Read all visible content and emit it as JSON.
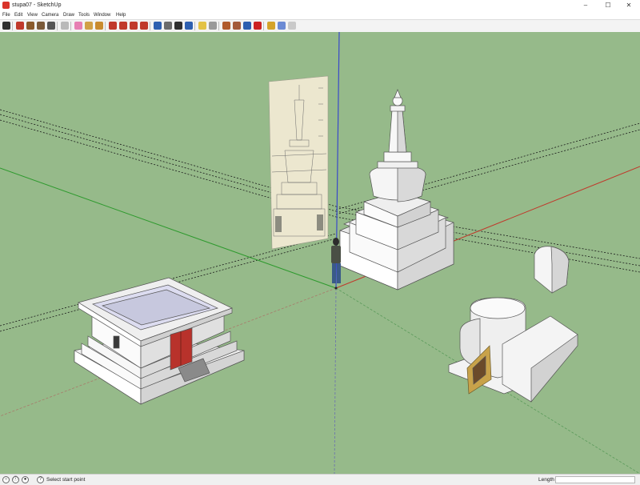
{
  "window": {
    "title": "stupa07 - SketchUp",
    "controls": {
      "minimize": "–",
      "maximize": "☐",
      "close": "✕"
    }
  },
  "menu": [
    "File",
    "Edit",
    "View",
    "Camera",
    "Draw",
    "Tools",
    "Window",
    "Help"
  ],
  "toolbar": {
    "tools": [
      {
        "name": "select-icon",
        "color": "#2f2f2f"
      },
      {
        "name": "line-icon",
        "color": "#c0392b"
      },
      {
        "name": "rectangle-icon",
        "color": "#8a5a2b"
      },
      {
        "name": "circle-icon",
        "color": "#7a5a3a"
      },
      {
        "name": "arc-icon",
        "color": "#555555"
      },
      {
        "name": "make-component-icon",
        "color": "#b9b9b9"
      },
      {
        "name": "eraser-icon",
        "color": "#e77fb3"
      },
      {
        "name": "tape-measure-icon",
        "color": "#d1a046"
      },
      {
        "name": "paint-bucket-icon",
        "color": "#c98b2e"
      },
      {
        "name": "push-pull-icon",
        "color": "#c0392b"
      },
      {
        "name": "move-icon",
        "color": "#c0392b"
      },
      {
        "name": "rotate-icon",
        "color": "#c0392b"
      },
      {
        "name": "offset-icon",
        "color": "#c0392b"
      },
      {
        "name": "orbit-icon",
        "color": "#2d5fb0"
      },
      {
        "name": "pan-icon",
        "color": "#6b6b6b"
      },
      {
        "name": "zoom-icon",
        "color": "#2f2f2f"
      },
      {
        "name": "zoom-extents-icon",
        "color": "#2d5fb0"
      },
      {
        "name": "add-location-icon",
        "color": "#e3c245"
      },
      {
        "name": "toggle-terrain-icon",
        "color": "#9a9a9a"
      },
      {
        "name": "get-models-icon",
        "color": "#b05a2b"
      },
      {
        "name": "share-model-icon",
        "color": "#a35a3a"
      },
      {
        "name": "share-component-icon",
        "color": "#2d5fb0"
      },
      {
        "name": "extension-warehouse-icon",
        "color": "#cc2222"
      },
      {
        "name": "ruby-console-icon",
        "color": "#d4a32a"
      },
      {
        "name": "styles-icon",
        "color": "#6b8ad4"
      },
      {
        "name": "layout-icon",
        "color": "#c9c9c9"
      }
    ]
  },
  "status": {
    "prompt": "Select start point",
    "measurements_label": "Length",
    "measurements_value": "",
    "icons": [
      "geo-location-icon",
      "credits-icon",
      "user-icon",
      "help-icon"
    ]
  },
  "scene": {
    "background_color": "#96ba8a",
    "axis_colors": {
      "red": "#c0392b",
      "green": "#2e9a2e",
      "blue": "#3949c9"
    }
  }
}
